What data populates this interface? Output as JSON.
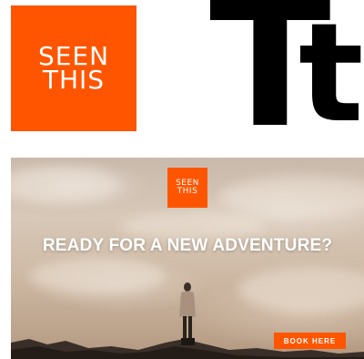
{
  "brand": {
    "logo_line1": "SEEN",
    "logo_line2": "THIS",
    "accent_color": "#ff5500"
  },
  "type_specimen": {
    "uppercase_glyph": "T",
    "lowercase_glyph": "t"
  },
  "banner": {
    "logo_line1": "SEEN",
    "logo_line2": "THIS",
    "headline": "READY FOR A NEW ADVENTURE?",
    "cta_label": "BOOK HERE",
    "image_subject": "hiker-above-clouds"
  }
}
